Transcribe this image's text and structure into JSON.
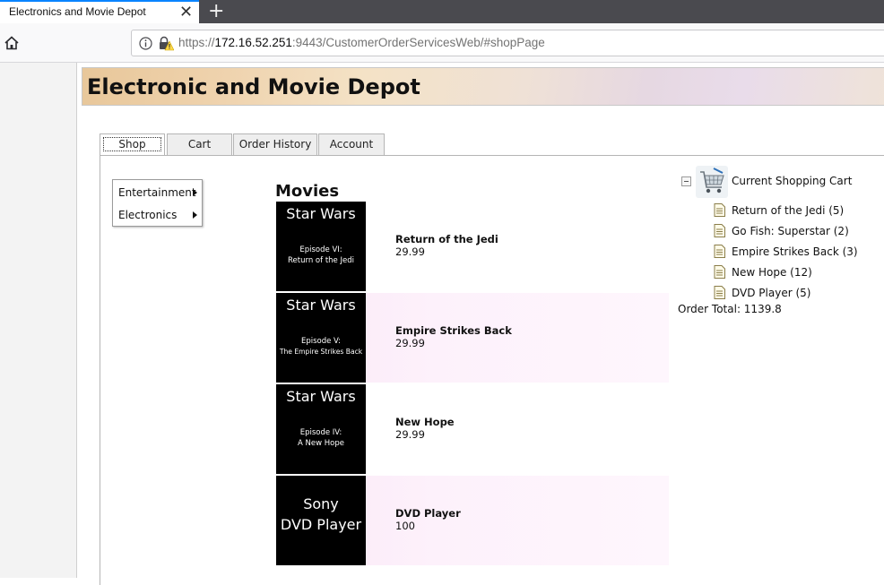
{
  "browser": {
    "tab_title": "Electronics and Movie Depot",
    "close_glyph": "✕",
    "newtab_glyph": "+",
    "url_scheme": "https://",
    "url_host": "172.16.52.251",
    "url_rest": ":9443/CustomerOrderServicesWeb/#shopPage",
    "icons": [
      "home-icon",
      "info-icon",
      "insecure-lock-icon",
      "close-icon",
      "plus-icon"
    ]
  },
  "banner": {
    "title": "Electronic and Movie Depot"
  },
  "tabs": [
    {
      "label": "Shop",
      "active": true
    },
    {
      "label": "Cart",
      "active": false
    },
    {
      "label": "Order History",
      "active": false
    },
    {
      "label": "Account",
      "active": false
    }
  ],
  "menu": {
    "items": [
      {
        "label": "Entertainment"
      },
      {
        "label": "Electronics"
      }
    ]
  },
  "catalog": {
    "section_title": "Movies",
    "products": [
      {
        "cover_title": "Star Wars",
        "cover_sub_1": "Episode VI:",
        "cover_sub_2": "Return of the Jedi",
        "name": "Return of the Jedi",
        "price": "29.99"
      },
      {
        "cover_title": "Star Wars",
        "cover_sub_1": "Episode V:",
        "cover_sub_2": "The Empire Strikes Back",
        "name": "Empire Strikes Back",
        "price": "29.99"
      },
      {
        "cover_title": "Star Wars",
        "cover_sub_1": "Episode IV:",
        "cover_sub_2": "A New Hope",
        "name": "New Hope",
        "price": "29.99"
      },
      {
        "cover_line_1": "Sony",
        "cover_line_2": "DVD Player",
        "name": "DVD Player",
        "price": "100"
      }
    ]
  },
  "cart": {
    "title": "Current Shopping Cart",
    "items": [
      {
        "label": "Return of the Jedi (5)"
      },
      {
        "label": "Go Fish: Superstar (2)"
      },
      {
        "label": "Empire Strikes Back (3)"
      },
      {
        "label": "New Hope (12)"
      },
      {
        "label": "DVD Player (5)"
      }
    ],
    "order_total": "Order Total: 1139.8"
  },
  "colors": {
    "tab_accent": "#0a84ff",
    "product_highlight": "#fbe8f6",
    "cover_bg": "#000000"
  }
}
